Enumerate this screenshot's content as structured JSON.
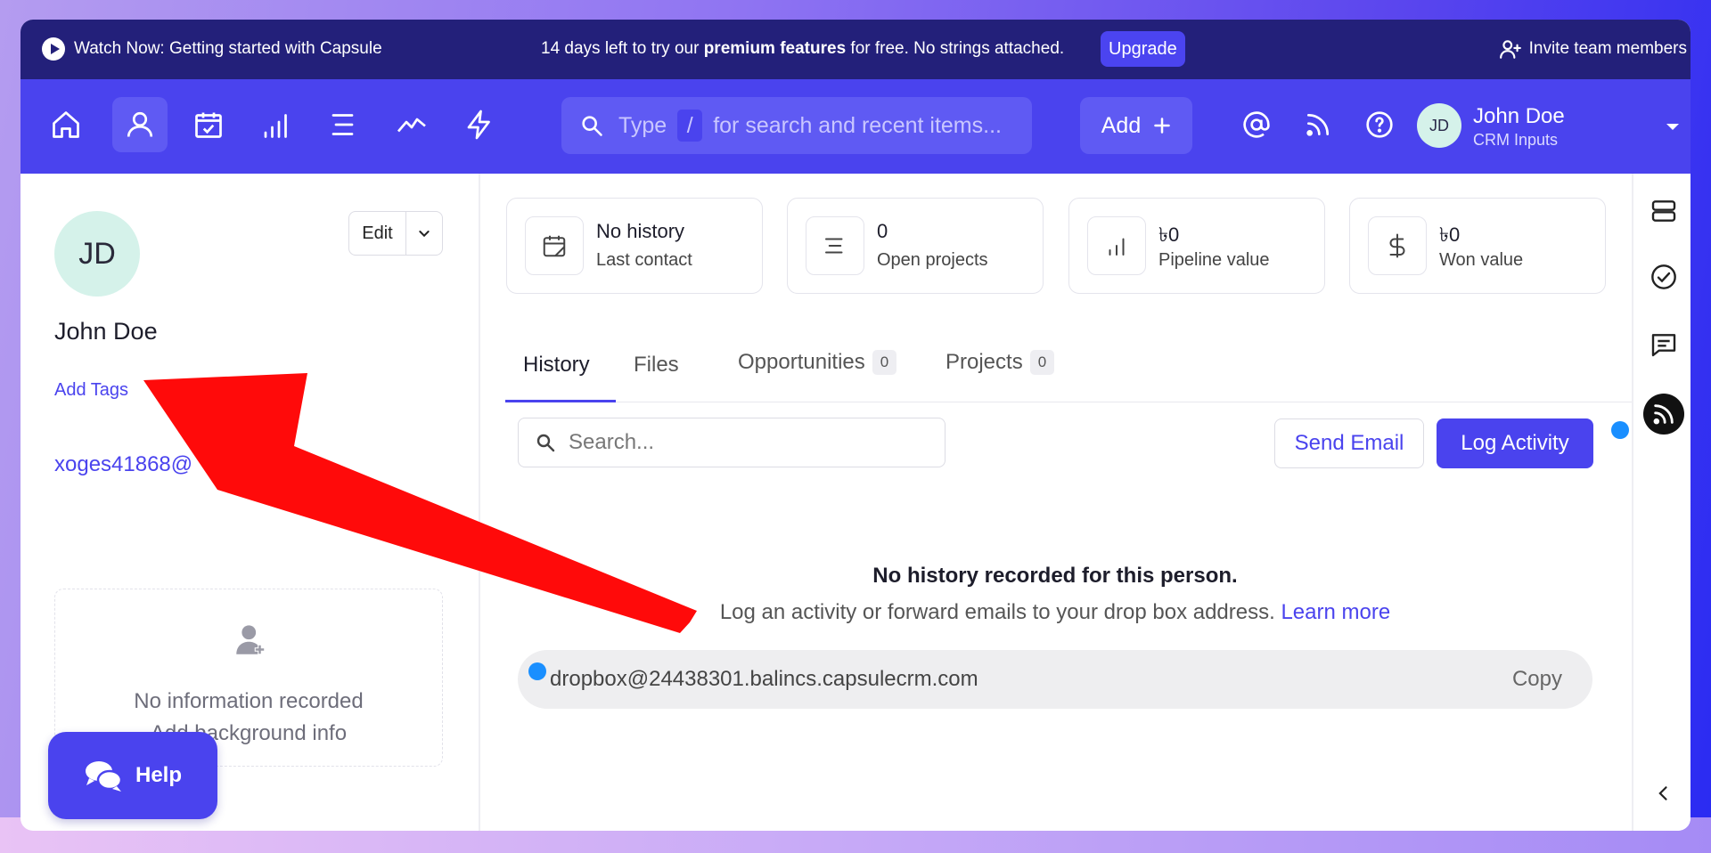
{
  "banner": {
    "watch_label": "Watch Now: Getting started with Capsule",
    "trial_prefix": "14 days left to try our ",
    "trial_bold": "premium features",
    "trial_suffix": " for free. No strings attached.",
    "upgrade_label": "Upgrade",
    "invite_label": "Invite team members"
  },
  "nav": {
    "items": [
      {
        "name": "home",
        "icon": "home-icon"
      },
      {
        "name": "people",
        "icon": "person-icon",
        "active": true
      },
      {
        "name": "calendar",
        "icon": "calendar-check-icon"
      },
      {
        "name": "pipeline",
        "icon": "bar-chart-icon"
      },
      {
        "name": "projects",
        "icon": "list-icon"
      },
      {
        "name": "reports",
        "icon": "trend-icon"
      },
      {
        "name": "workflows",
        "icon": "lightning-icon"
      }
    ],
    "search": {
      "type_word": "Type",
      "slash": "/",
      "placeholder": "for search and recent items..."
    },
    "add_label": "Add",
    "user": {
      "initials": "JD",
      "name": "John Doe",
      "sub": "CRM Inputs"
    }
  },
  "profile": {
    "initials": "JD",
    "edit_label": "Edit",
    "name": "John Doe",
    "add_tags": "Add Tags",
    "email": "xoges41868@",
    "info": {
      "line1": "No information recorded",
      "line2": "Add background info"
    }
  },
  "help_label": "Help",
  "stats": [
    {
      "value": "No history",
      "label": "Last contact",
      "icon": "calendar-note-icon"
    },
    {
      "value": "0",
      "label": "Open projects",
      "icon": "list-icon"
    },
    {
      "value": "৳0",
      "label": "Pipeline value",
      "icon": "bar-chart-icon"
    },
    {
      "value": "৳0",
      "label": "Won value",
      "icon": "dollar-icon"
    }
  ],
  "tabs": [
    {
      "label": "History",
      "active": true
    },
    {
      "label": "Files"
    },
    {
      "label": "Opportunities",
      "badge": "0"
    },
    {
      "label": "Projects",
      "badge": "0"
    }
  ],
  "history": {
    "search_placeholder": "Search...",
    "send_email": "Send Email",
    "log_activity": "Log Activity",
    "empty_title": "No history recorded for this person.",
    "empty_sub": "Log an activity or forward emails to your drop box address.",
    "learn_more": "Learn more",
    "dropbox_address": "dropbox@24438301.balincs.capsulecrm.com",
    "copy_label": "Copy"
  },
  "rail": [
    "stack-icon",
    "check-circle-icon",
    "message-icon",
    "feed-icon",
    "chevron-left-icon"
  ],
  "colors": {
    "accent": "#4a43ee",
    "banner": "#23207a",
    "arrow": "#ff0a0a",
    "dot": "#1a8fff"
  }
}
